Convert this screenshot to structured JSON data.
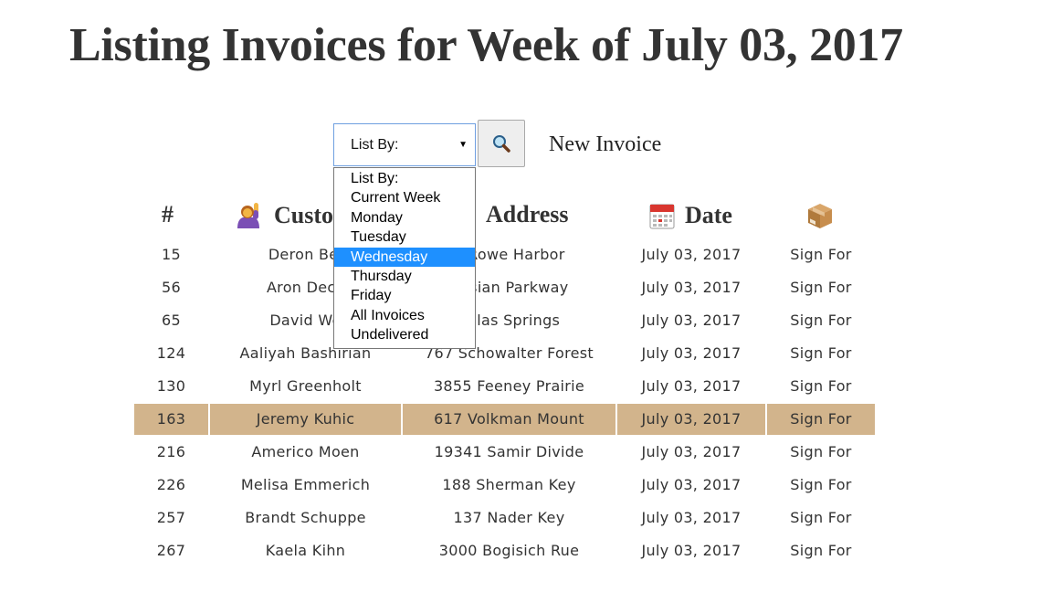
{
  "page": {
    "title": "Listing Invoices for Week of July 03, 2017"
  },
  "toolbar": {
    "select_value": "List By:",
    "search_icon": "magnifier-icon",
    "new_invoice_label": "New Invoice"
  },
  "dropdown": {
    "options": [
      "List By:",
      "Current Week",
      "Monday",
      "Tuesday",
      "Wednesday",
      "Thursday",
      "Friday",
      "All Invoices",
      "Undelivered"
    ],
    "highlighted": "Wednesday",
    "highlight_color": "#1e90ff"
  },
  "table": {
    "headers": {
      "number": "#",
      "customer": "Customer",
      "address": "Address",
      "date": "Date"
    },
    "header_icons": {
      "customer": "person-raising-hand-icon",
      "date": "calendar-icon",
      "sign": "package-icon"
    },
    "highlight_color": "#d2b48c",
    "rows": [
      {
        "num": "15",
        "customer": "Deron Bei",
        "address": "5 Rowe Harbor",
        "date": "July 03, 2017",
        "action": "Sign For"
      },
      {
        "num": "56",
        "customer": "Aron Deck",
        "address": "arisian Parkway",
        "date": "July 03, 2017",
        "action": "Sign For"
      },
      {
        "num": "65",
        "customer": "David Wo",
        "address": "Kulas Springs",
        "date": "July 03, 2017",
        "action": "Sign For"
      },
      {
        "num": "124",
        "customer": "Aaliyah Bashirian",
        "address": "767 Schowalter Forest",
        "date": "July 03, 2017",
        "action": "Sign For"
      },
      {
        "num": "130",
        "customer": "Myrl Greenholt",
        "address": "3855 Feeney Prairie",
        "date": "July 03, 2017",
        "action": "Sign For"
      },
      {
        "num": "163",
        "customer": "Jeremy Kuhic",
        "address": "617 Volkman Mount",
        "date": "July 03, 2017",
        "action": "Sign For",
        "highlighted": true
      },
      {
        "num": "216",
        "customer": "Americo Moen",
        "address": "19341 Samir Divide",
        "date": "July 03, 2017",
        "action": "Sign For"
      },
      {
        "num": "226",
        "customer": "Melisa Emmerich",
        "address": "188 Sherman Key",
        "date": "July 03, 2017",
        "action": "Sign For"
      },
      {
        "num": "257",
        "customer": "Brandt Schuppe",
        "address": "137 Nader Key",
        "date": "July 03, 2017",
        "action": "Sign For"
      },
      {
        "num": "267",
        "customer": "Kaela Kihn",
        "address": "3000 Bogisich Rue",
        "date": "July 03, 2017",
        "action": "Sign For"
      }
    ]
  }
}
